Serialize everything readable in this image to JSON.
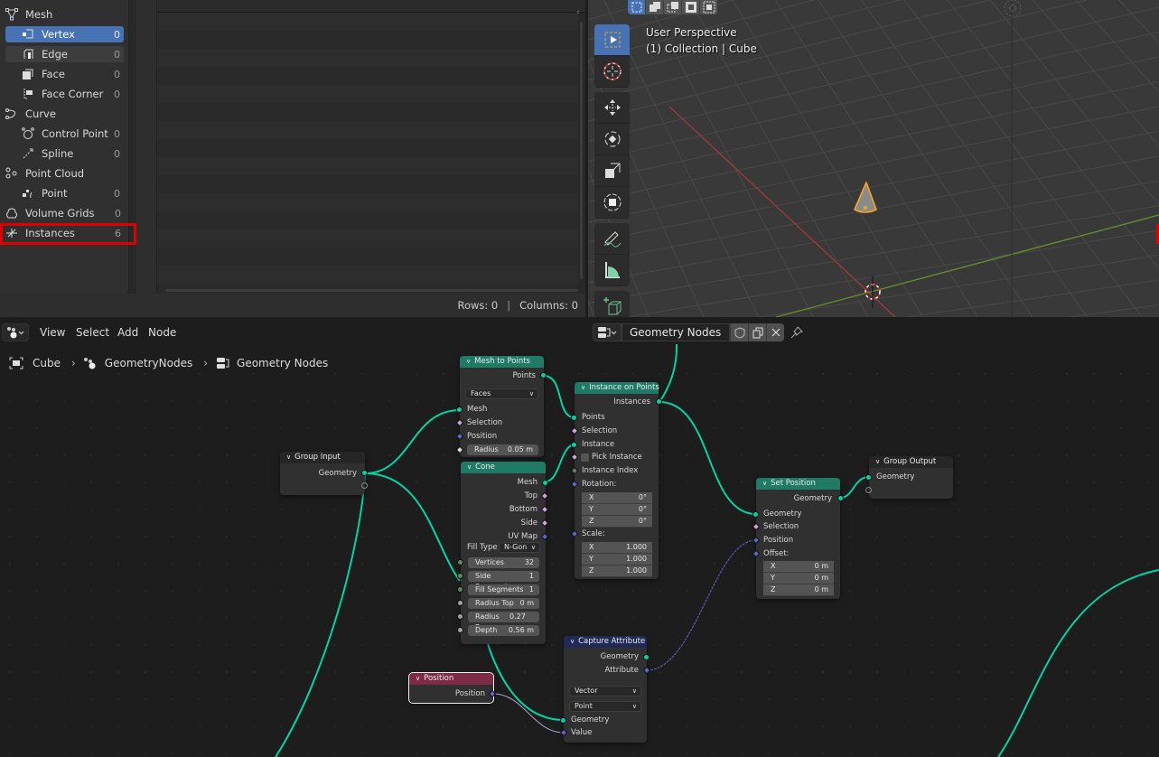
{
  "spreadsheet": {
    "tree": [
      {
        "label": "Mesh",
        "count": null,
        "level": 0,
        "icon": "mesh-icon"
      },
      {
        "label": "Vertex",
        "count": "0",
        "level": 1,
        "icon": "vertex-icon",
        "state": "selected"
      },
      {
        "label": "Edge",
        "count": "0",
        "level": 1,
        "icon": "edge-icon",
        "state": "hover"
      },
      {
        "label": "Face",
        "count": "0",
        "level": 1,
        "icon": "face-icon"
      },
      {
        "label": "Face Corner",
        "count": "0",
        "level": 1,
        "icon": "face-corner-icon"
      },
      {
        "label": "Curve",
        "count": null,
        "level": 0,
        "icon": "curve-icon"
      },
      {
        "label": "Control Point",
        "count": "0",
        "level": 1,
        "icon": "control-point-icon"
      },
      {
        "label": "Spline",
        "count": "0",
        "level": 1,
        "icon": "spline-icon"
      },
      {
        "label": "Point Cloud",
        "count": null,
        "level": 0,
        "icon": "point-cloud-icon"
      },
      {
        "label": "Point",
        "count": "0",
        "level": 1,
        "icon": "point-icon"
      },
      {
        "label": "Volume Grids",
        "count": "0",
        "level": 0,
        "icon": "volume-icon"
      },
      {
        "label": "Instances",
        "count": "6",
        "level": 0,
        "icon": "instances-icon",
        "state": "highlighted"
      }
    ],
    "footer": {
      "rows": "Rows: 0",
      "separator": "|",
      "columns": "Columns: 0"
    }
  },
  "viewport": {
    "perspective_label": "User Perspective",
    "collection_label": "(1) Collection | Cube",
    "select_modes": [
      "select-set-icon",
      "select-extend-icon",
      "select-subtract-icon",
      "select-difference-icon",
      "select-intersect-icon"
    ],
    "tools": [
      "select-box-icon",
      "cursor-icon",
      "move-icon",
      "rotate-icon",
      "scale-icon",
      "transform-icon",
      "annotate-icon",
      "measure-icon",
      "add-cube-icon"
    ],
    "colors": {
      "x_axis": "#9a3a44",
      "y_axis": "#6a8f2a",
      "selection": "#f5a623"
    }
  },
  "node_editor": {
    "menu": [
      "View",
      "Select",
      "Add",
      "Node"
    ],
    "breadcrumb": [
      "Cube",
      "GeometryNodes",
      "Geometry Nodes"
    ],
    "node_group_name": "Geometry Nodes",
    "nodes": {
      "group_input": {
        "title": "Group Input",
        "outputs": [
          "Geometry"
        ]
      },
      "mesh_to_points": {
        "title": "Mesh to Points",
        "output": "Points",
        "mode": "Faces",
        "inputs": [
          "Mesh",
          "Selection",
          "Position"
        ],
        "radius_label": "Radius",
        "radius_value": "0.05 m"
      },
      "cone": {
        "title": "Cone",
        "outputs": [
          "Mesh",
          "Top",
          "Bottom",
          "Side",
          "UV Map"
        ],
        "fill_type_label": "Fill Type",
        "fill_type": "N-Gon",
        "fields": [
          {
            "label": "Vertices",
            "value": "32"
          },
          {
            "label": "Side Segments",
            "value": "1"
          },
          {
            "label": "Fill Segments",
            "value": "1"
          },
          {
            "label": "Radius Top",
            "value": "0 m"
          },
          {
            "label": "Radius Bo",
            "value": "0.27 m"
          },
          {
            "label": "Depth",
            "value": "0.56 m"
          }
        ]
      },
      "instance_on_points": {
        "title": "Instance on Points",
        "output": "Instances",
        "inputs": [
          "Points",
          "Selection",
          "Instance"
        ],
        "pick_instance": "Pick Instance",
        "instance_index": "Instance Index",
        "rotation_label": "Rotation:",
        "rotation": [
          {
            "axis": "X",
            "value": "0°"
          },
          {
            "axis": "Y",
            "value": "0°"
          },
          {
            "axis": "Z",
            "value": "0°"
          }
        ],
        "scale_label": "Scale:",
        "scale": [
          {
            "axis": "X",
            "value": "1.000"
          },
          {
            "axis": "Y",
            "value": "1.000"
          },
          {
            "axis": "Z",
            "value": "1.000"
          }
        ]
      },
      "set_position": {
        "title": "Set Position",
        "output": "Geometry",
        "inputs": [
          "Geometry",
          "Selection",
          "Position"
        ],
        "offset_label": "Offset:",
        "offset": [
          {
            "axis": "X",
            "value": "0 m"
          },
          {
            "axis": "Y",
            "value": "0 m"
          },
          {
            "axis": "Z",
            "value": "0 m"
          }
        ]
      },
      "group_output": {
        "title": "Group Output",
        "inputs": [
          "Geometry"
        ]
      },
      "capture_attribute": {
        "title": "Capture Attribute",
        "outputs": [
          "Geometry",
          "Attribute"
        ],
        "data_type": "Vector",
        "domain": "Point",
        "inputs": [
          "Geometry",
          "Value"
        ]
      },
      "position": {
        "title": "Position",
        "output": "Position"
      }
    },
    "colors": {
      "geometry_link": "#00d6a3",
      "vector_link": "#6363c7",
      "geometry_header": "#1f7a66",
      "attribute_header": "#1f2a57",
      "input_header": "#7c2a45"
    }
  }
}
